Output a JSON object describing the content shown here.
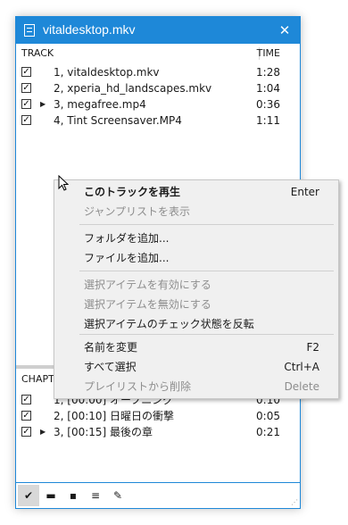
{
  "window": {
    "title": "vitaldesktop.mkv",
    "close_glyph": "✕",
    "accent_color": "#1e88d8"
  },
  "tracks": {
    "header_track": "TRACK",
    "header_time": "TIME",
    "items": [
      {
        "label": "1, vitaldesktop.mkv",
        "time": "1:28",
        "checked": true,
        "playing": false
      },
      {
        "label": "2, xperia_hd_landscapes.mkv",
        "time": "1:04",
        "checked": true,
        "playing": false
      },
      {
        "label": "3, megafree.mp4",
        "time": "0:36",
        "checked": true,
        "playing": true
      },
      {
        "label": "4, Tint Screensaver.MP4",
        "time": "1:11",
        "checked": true,
        "playing": false
      }
    ]
  },
  "chapters": {
    "header": "CHAPT",
    "items": [
      {
        "label": "1, [00:00] オープニング",
        "time": "0:10",
        "checked": true,
        "playing": false
      },
      {
        "label": "2, [00:10] 日曜日の衝撃",
        "time": "0:05",
        "checked": true,
        "playing": false
      },
      {
        "label": "3, [00:15] 最後の章",
        "time": "0:21",
        "checked": true,
        "playing": true
      }
    ]
  },
  "toolbar": {
    "buttons": [
      {
        "icon": "check-icon",
        "glyph": "✔"
      },
      {
        "icon": "folder-icon",
        "glyph": "▬"
      },
      {
        "icon": "save-icon",
        "glyph": "▪"
      },
      {
        "icon": "sort-icon",
        "glyph": "≡"
      },
      {
        "icon": "wrench-icon",
        "glyph": "✎"
      }
    ]
  },
  "context_menu": {
    "items": [
      {
        "label": "このトラックを再生",
        "key": "Enter",
        "disabled": false,
        "bold": true
      },
      {
        "label": "ジャンプリストを表示",
        "key": "",
        "disabled": true,
        "bold": false
      },
      {
        "label": "フォルダを追加...",
        "key": "",
        "disabled": false,
        "bold": false
      },
      {
        "label": "ファイルを追加...",
        "key": "",
        "disabled": false,
        "bold": false
      },
      {
        "label": "選択アイテムを有効にする",
        "key": "",
        "disabled": true,
        "bold": false
      },
      {
        "label": "選択アイテムを無効にする",
        "key": "",
        "disabled": true,
        "bold": false
      },
      {
        "label": "選択アイテムのチェック状態を反転",
        "key": "",
        "disabled": false,
        "bold": false
      },
      {
        "label": "名前を変更",
        "key": "F2",
        "disabled": false,
        "bold": false
      },
      {
        "label": "すべて選択",
        "key": "Ctrl+A",
        "disabled": false,
        "bold": false
      },
      {
        "label": "プレイリストから削除",
        "key": "Delete",
        "disabled": true,
        "bold": false
      }
    ]
  }
}
